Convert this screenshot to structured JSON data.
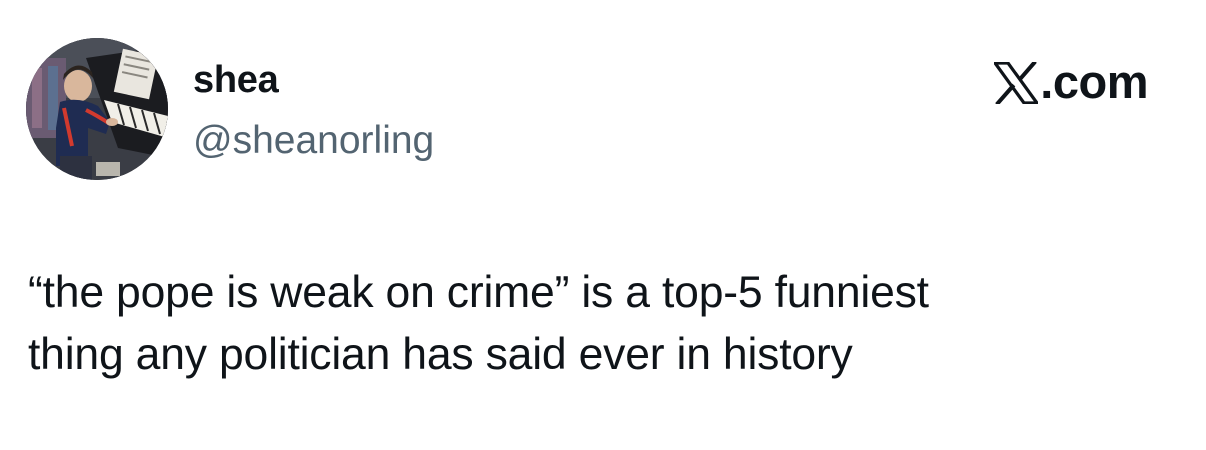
{
  "tweet": {
    "author": {
      "display_name": "shea",
      "handle": "@sheanorling",
      "avatar_icon": "avatar-photo-child-at-piano"
    },
    "platform": {
      "icon": "x-logo-icon",
      "label": ".com"
    },
    "text_lines": [
      "“the pope is weak on crime” is a top-5 funniest",
      "thing any politician has said ever in history"
    ]
  },
  "colors": {
    "background": "#ffffff",
    "text_primary": "#0f1419",
    "text_secondary": "#536471"
  }
}
